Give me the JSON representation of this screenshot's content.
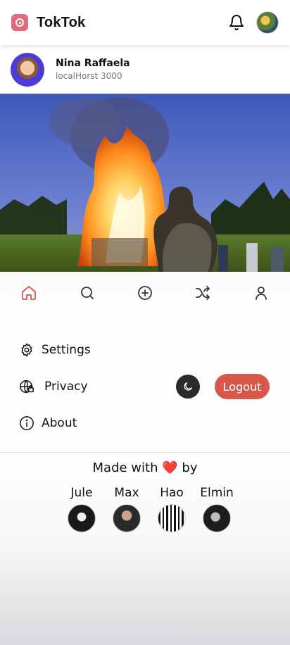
{
  "app": {
    "title": "TokTok",
    "brand_color": "#e06a78"
  },
  "header": {
    "notification_icon": "bell-icon",
    "avatar_icon": "user-avatar"
  },
  "profile": {
    "name": "Nina Raffaela",
    "subtitle": "localHorst 3000"
  },
  "nav": {
    "items": [
      {
        "name": "home",
        "icon": "home-icon",
        "active": true
      },
      {
        "name": "search",
        "icon": "search-icon",
        "active": false
      },
      {
        "name": "create",
        "icon": "plus-circle-icon",
        "active": false
      },
      {
        "name": "shuffle",
        "icon": "shuffle-icon",
        "active": false
      },
      {
        "name": "profile",
        "icon": "person-icon",
        "active": false
      }
    ],
    "active_color": "#d7574b"
  },
  "menu": {
    "settings": "Settings",
    "privacy": "Privacy",
    "about": "About",
    "logout": "Logout",
    "logout_color": "#d7574b"
  },
  "credits": {
    "made_with_prefix": "Made with",
    "made_with_suffix": "by",
    "heart": "❤️",
    "members": [
      "Jule",
      "Max",
      "Hao",
      "Elmin"
    ]
  }
}
